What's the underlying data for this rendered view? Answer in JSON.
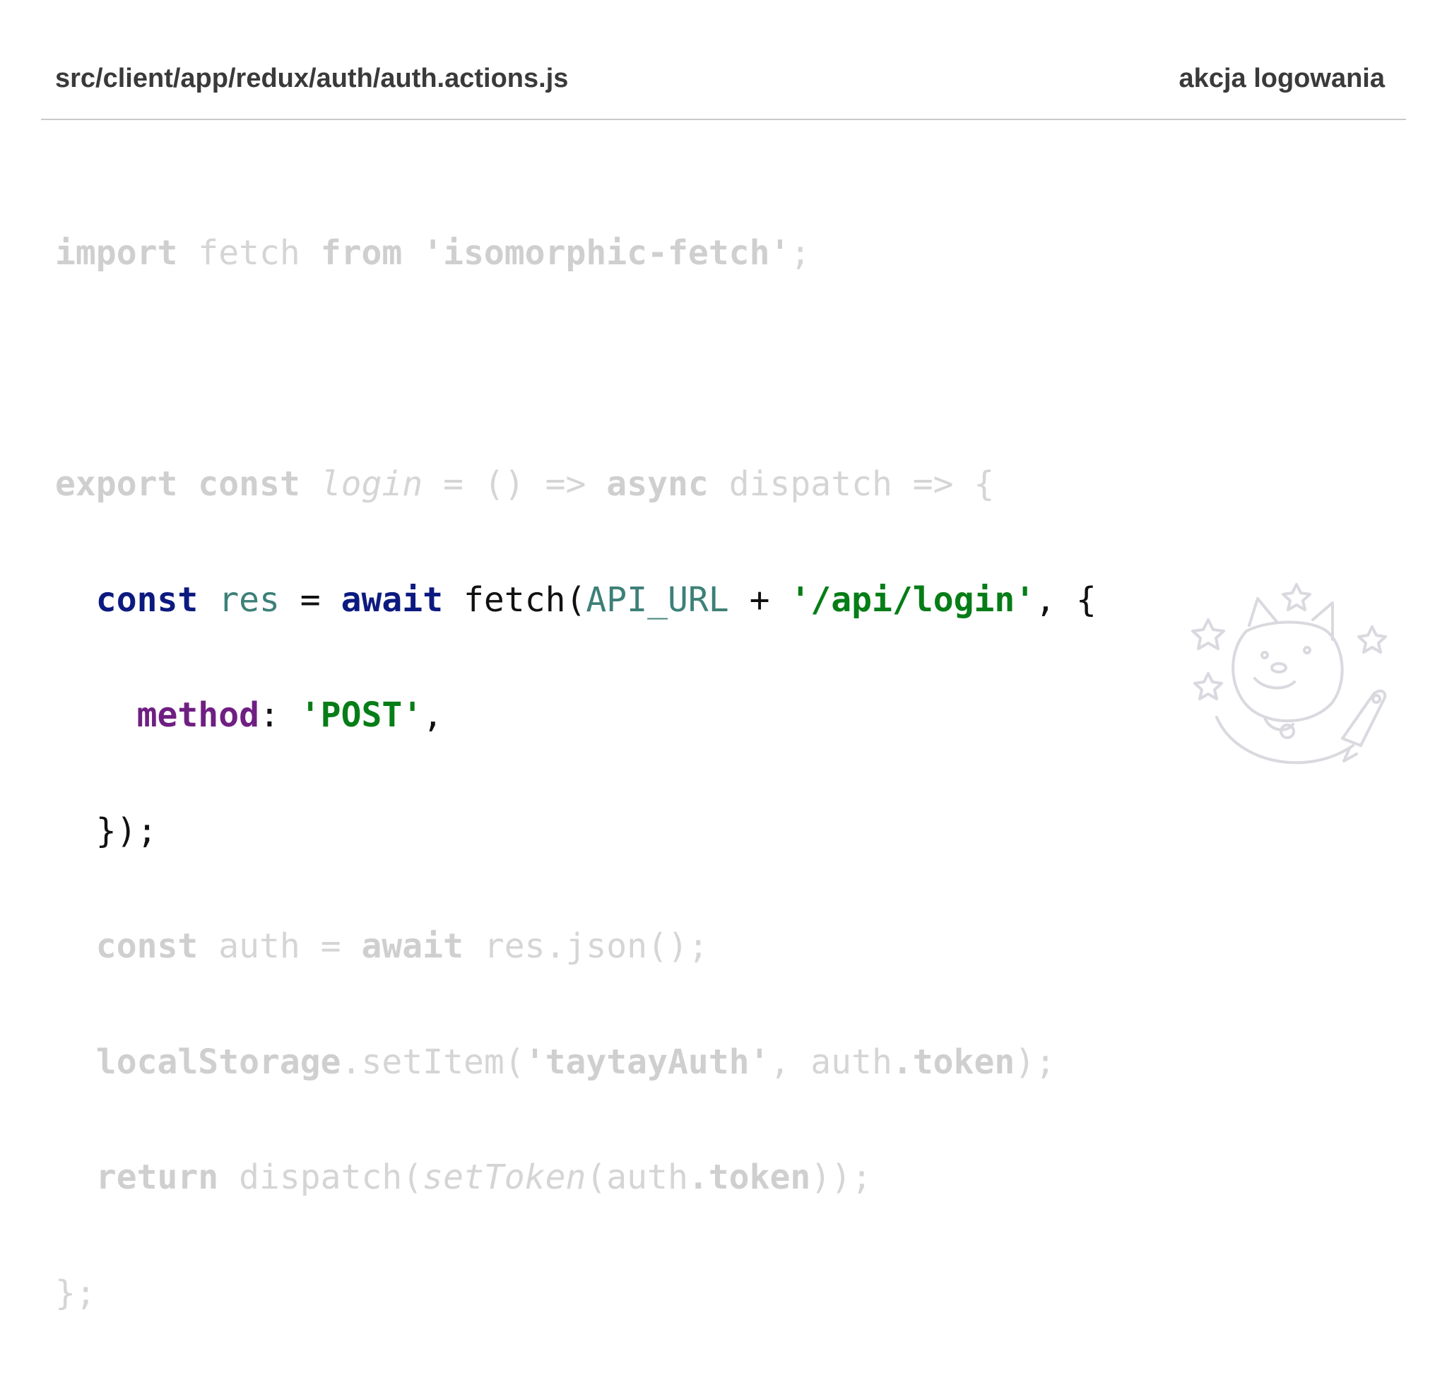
{
  "header": {
    "file_path": "src/client/app/redux/auth/auth.actions.js",
    "slide_title": "akcja logowania"
  },
  "code": {
    "l1": {
      "t1": "import",
      "t2": " fetch ",
      "t3": "from",
      "t4": " ",
      "t5": "'isomorphic-fetch'",
      "t6": ";"
    },
    "l3": {
      "t1": "export",
      "t2": " ",
      "t3": "const",
      "t4": " ",
      "t5": "login",
      "t6": " = () => ",
      "t7": "async",
      "t8": " dispatch => {"
    },
    "l4": {
      "t1": "  ",
      "t2": "const",
      "t3": " ",
      "t4": "res",
      "t5": " = ",
      "t6": "await",
      "t7": " fetch(",
      "t8": "API_URL",
      "t9": " + ",
      "t10": "'/api/login'",
      "t11": ", {"
    },
    "l5": {
      "t1": "    ",
      "t2": "method",
      "t3": ": ",
      "t4": "'POST'",
      "t5": ","
    },
    "l6": {
      "t1": "  });"
    },
    "l7": {
      "t1": "  ",
      "t2": "const",
      "t3": " auth = ",
      "t4": "await",
      "t5": " res.json();"
    },
    "l8": {
      "t1": "  ",
      "t2": "localStorage",
      "t3": ".setItem(",
      "t4": "'taytayAuth'",
      "t5": ", auth",
      "t6": ".",
      "t7": "token",
      "t8": ");"
    },
    "l9": {
      "t1": "  ",
      "t2": "return",
      "t3": " dispatch(",
      "t4": "setToken",
      "t5": "(auth",
      "t6": ".",
      "t7": "token",
      "t8": "));"
    },
    "l10": {
      "t1": "};"
    }
  },
  "decoration": {
    "icon": "doge-astronaut-icon"
  },
  "colors": {
    "keyword": "#0c1a80",
    "variable": "#3d8078",
    "string": "#067d17",
    "property": "#6f1f82",
    "dimmed": "#d5d5d5"
  }
}
